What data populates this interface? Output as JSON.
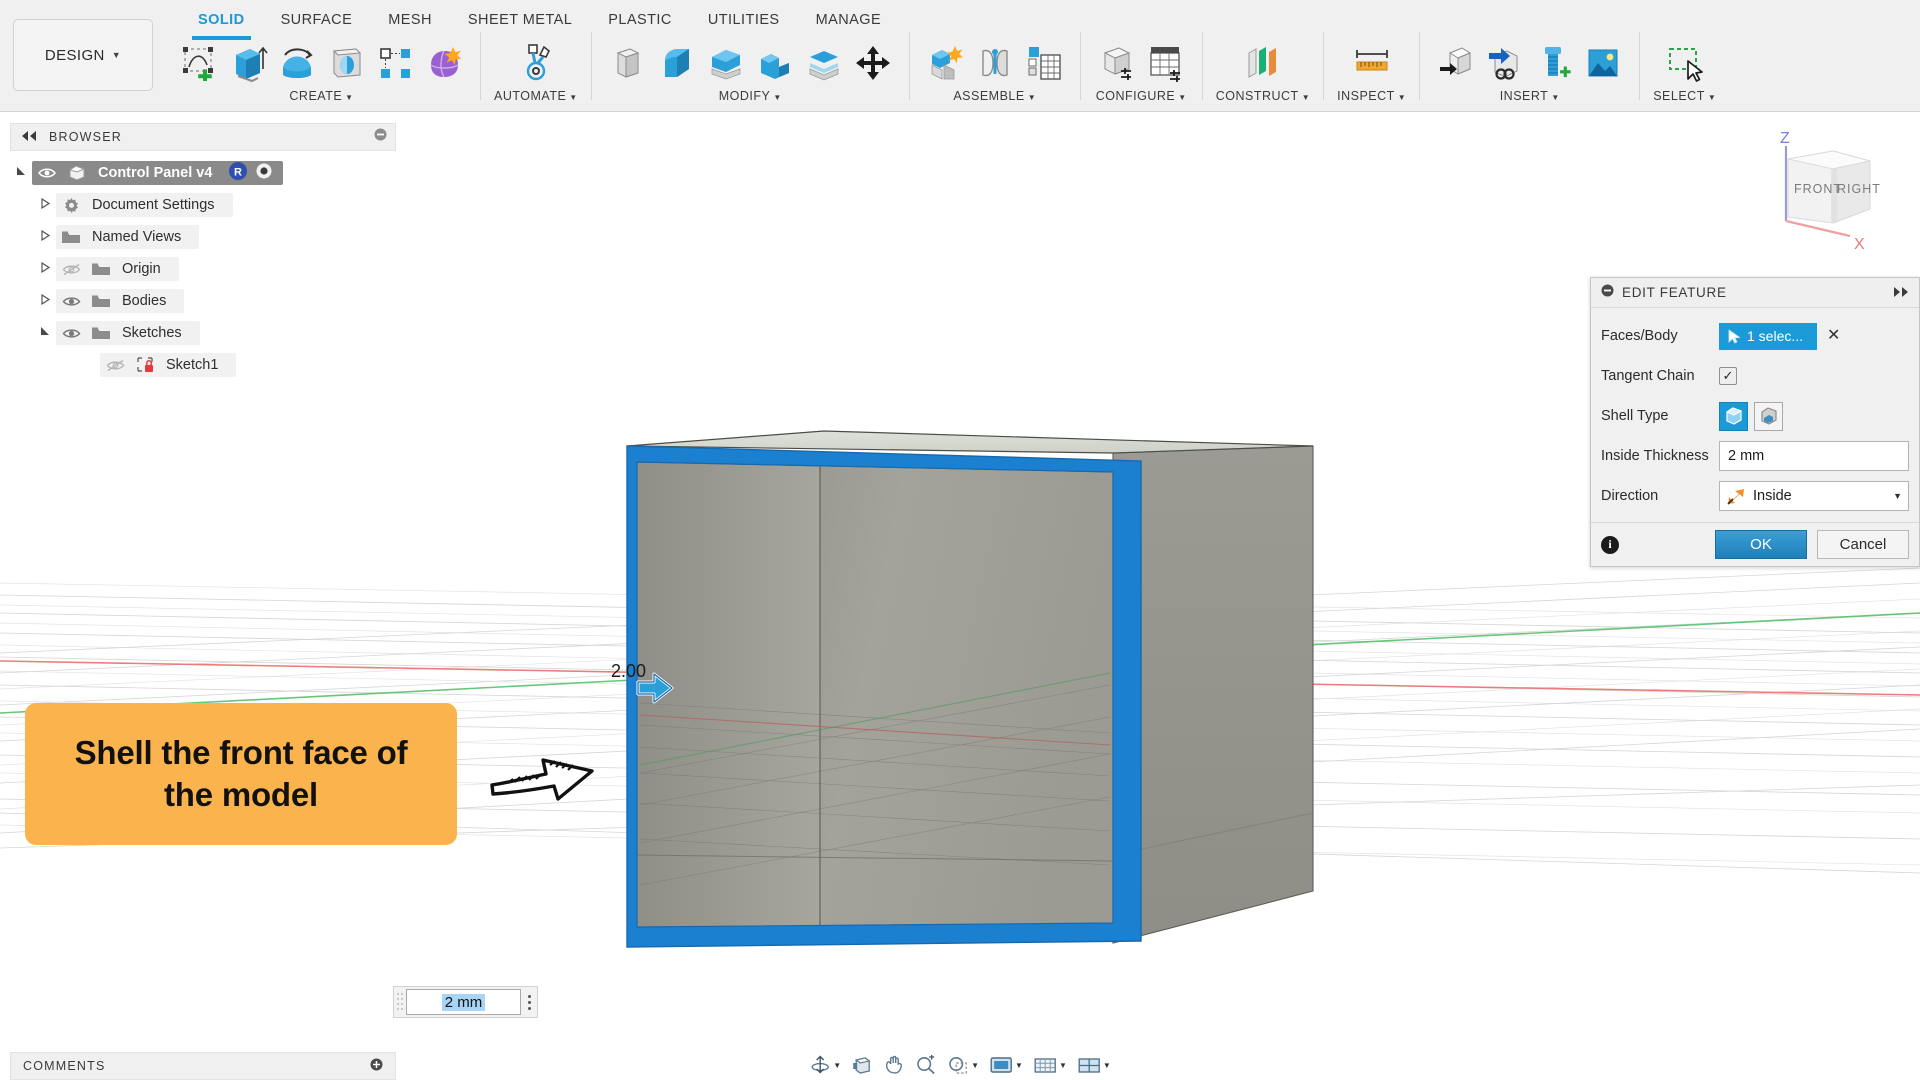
{
  "app": {
    "workspace_button": "DESIGN",
    "tabs": [
      {
        "label": "SOLID",
        "active": true
      },
      {
        "label": "SURFACE",
        "active": false
      },
      {
        "label": "MESH",
        "active": false
      },
      {
        "label": "SHEET METAL",
        "active": false
      },
      {
        "label": "PLASTIC",
        "active": false
      },
      {
        "label": "UTILITIES",
        "active": false
      },
      {
        "label": "MANAGE",
        "active": false
      }
    ],
    "ribbon_groups": [
      {
        "name": "CREATE",
        "dropdown": true,
        "icons": [
          "create-sketch-icon",
          "extrude-icon",
          "revolve-icon",
          "hole-icon",
          "pattern-icon",
          "form-icon"
        ]
      },
      {
        "name": "AUTOMATE",
        "dropdown": true,
        "icons": [
          "automate-icon"
        ]
      },
      {
        "name": "MODIFY",
        "dropdown": true,
        "icons": [
          "press-pull-icon",
          "fillet-icon",
          "shell-icon",
          "combine-icon",
          "offset-face-icon",
          "move-copy-icon"
        ]
      },
      {
        "name": "ASSEMBLE",
        "dropdown": true,
        "icons": [
          "new-component-icon",
          "joint-icon",
          "assembly-table-icon"
        ]
      },
      {
        "name": "CONFIGURE",
        "dropdown": true,
        "icons": [
          "configure-body-icon",
          "configuration-table-icon"
        ]
      },
      {
        "name": "CONSTRUCT",
        "dropdown": true,
        "icons": [
          "offset-plane-icon"
        ]
      },
      {
        "name": "INSPECT",
        "dropdown": true,
        "icons": [
          "measure-icon"
        ]
      },
      {
        "name": "INSERT",
        "dropdown": true,
        "icons": [
          "derive-icon",
          "insert-derive-link-icon",
          "mcmaster-part-icon",
          "canvas-image-icon"
        ]
      },
      {
        "name": "SELECT",
        "dropdown": true,
        "icons": [
          "select-window-icon"
        ]
      }
    ]
  },
  "browser": {
    "header_label": "BROWSER",
    "collapse_icon": "collapse-left-icon",
    "minimize_icon": "minimize-icon",
    "items": [
      {
        "label": "Control Panel v4",
        "indent": 0,
        "arrow": "expanded",
        "eye": "visible",
        "icon": "component-icon",
        "selected": true,
        "badges": [
          "revision-badge-R",
          "radio-badge"
        ]
      },
      {
        "label": "Document Settings",
        "indent": 1,
        "arrow": "collapsed",
        "eye": "none",
        "icon": "gear-icon",
        "selected": false
      },
      {
        "label": "Named Views",
        "indent": 1,
        "arrow": "collapsed",
        "eye": "none",
        "icon": "folder-icon",
        "selected": false
      },
      {
        "label": "Origin",
        "indent": 1,
        "arrow": "collapsed",
        "eye": "hidden",
        "icon": "folder-icon",
        "selected": false
      },
      {
        "label": "Bodies",
        "indent": 1,
        "arrow": "collapsed",
        "eye": "visible",
        "icon": "folder-icon",
        "selected": false
      },
      {
        "label": "Sketches",
        "indent": 1,
        "arrow": "expanded",
        "eye": "visible",
        "icon": "folder-icon",
        "selected": false
      },
      {
        "label": "Sketch1",
        "indent": 2,
        "arrow": "none",
        "eye": "hidden",
        "icon": "sketch-locked-icon",
        "selected": false
      }
    ]
  },
  "dialog": {
    "title": "EDIT FEATURE",
    "collapse_icon": "collapse-dialog-icon",
    "expand_icon": "expand-right-icon",
    "rows": [
      {
        "label": "Faces/Body",
        "type": "selection",
        "value": "1 selec...",
        "clear_icon": "clear-selection-icon"
      },
      {
        "label": "Tangent Chain",
        "type": "checkbox",
        "checked": true
      },
      {
        "label": "Shell Type",
        "type": "toggle",
        "options": [
          "shell-new-body-icon",
          "shell-existing-icon"
        ],
        "selected_index": 0
      },
      {
        "label": "Inside Thickness",
        "type": "text",
        "value": "2 mm"
      },
      {
        "label": "Direction",
        "type": "select",
        "value": "Inside",
        "icon": "direction-inside-icon"
      }
    ],
    "info_icon": "info-icon",
    "ok_label": "OK",
    "cancel_label": "Cancel"
  },
  "callout": {
    "text": "Shell the front face of the model",
    "background_color": "#fbb44d",
    "arrow_icon": "hand-drawn-arrow-right-icon"
  },
  "canvas": {
    "dimension_label": "2.00",
    "manipulator_icon": "drag-arrow-right-icon",
    "dimension_input_value": "2 mm",
    "input_drag_handle_icon": "drag-handle-icon",
    "input_more_icon": "more-options-icon",
    "selected_edge_color": "#1b80cf",
    "body_color": "#9a9a92"
  },
  "viewcube": {
    "front_label": "FRONT",
    "right_label": "RIGHT",
    "z_axis_label": "Z",
    "x_axis_label": "X"
  },
  "bottom": {
    "comments_label": "COMMENTS",
    "comments_icon": "add-comment-icon",
    "nav_icons": [
      "orbit-icon",
      "look-at-icon",
      "pan-icon",
      "zoom-icon",
      "zoom-window-icon",
      "display-settings-icon",
      "grid-snap-icon",
      "viewports-icon"
    ]
  }
}
